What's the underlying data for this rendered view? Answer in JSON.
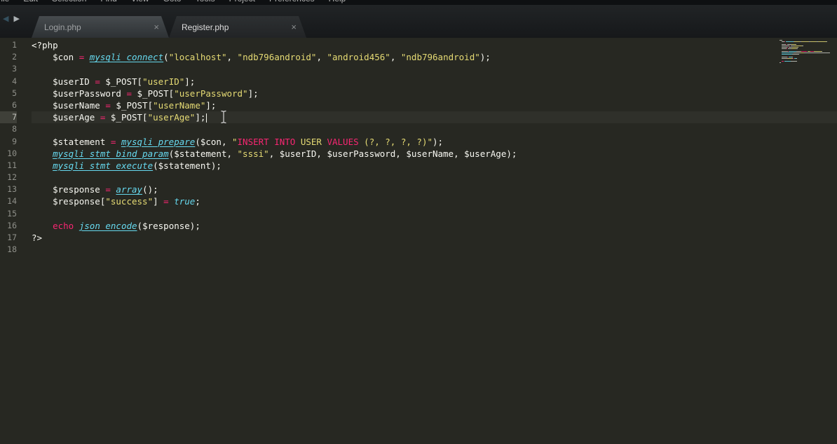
{
  "menu": {
    "items": [
      "File",
      "Edit",
      "Selection",
      "Find",
      "View",
      "Goto",
      "Tools",
      "Project",
      "Preferences",
      "Help"
    ]
  },
  "icons": {
    "back": "◀",
    "forward": "▶",
    "close": "×"
  },
  "tabs": [
    {
      "label": "Login.php",
      "active": false
    },
    {
      "label": "Register.php",
      "active": true
    }
  ],
  "editor": {
    "language": "PHP",
    "active_line": 7,
    "total_lines": 18,
    "lines": [
      {
        "num": 1,
        "segments": [
          [
            "plain",
            "<?php"
          ]
        ]
      },
      {
        "num": 2,
        "segments": [
          [
            "plain",
            "    $con "
          ],
          [
            "op",
            "="
          ],
          [
            "plain",
            " "
          ],
          [
            "fn",
            "mysqli_connect"
          ],
          [
            "plain",
            "("
          ],
          [
            "str",
            "\"localhost\""
          ],
          [
            "plain",
            ", "
          ],
          [
            "str",
            "\"ndb796android\""
          ],
          [
            "plain",
            ", "
          ],
          [
            "str",
            "\"android456\""
          ],
          [
            "plain",
            ", "
          ],
          [
            "str",
            "\"ndb796android\""
          ],
          [
            "plain",
            ");"
          ]
        ]
      },
      {
        "num": 3,
        "segments": []
      },
      {
        "num": 4,
        "segments": [
          [
            "plain",
            "    $userID "
          ],
          [
            "op",
            "="
          ],
          [
            "plain",
            " $_POST["
          ],
          [
            "str",
            "\"userID\""
          ],
          [
            "plain",
            "];"
          ]
        ]
      },
      {
        "num": 5,
        "segments": [
          [
            "plain",
            "    $userPassword "
          ],
          [
            "op",
            "="
          ],
          [
            "plain",
            " $_POST["
          ],
          [
            "str",
            "\"userPassword\""
          ],
          [
            "plain",
            "];"
          ]
        ]
      },
      {
        "num": 6,
        "segments": [
          [
            "plain",
            "    $userName "
          ],
          [
            "op",
            "="
          ],
          [
            "plain",
            " $_POST["
          ],
          [
            "str",
            "\"userName\""
          ],
          [
            "plain",
            "];"
          ]
        ]
      },
      {
        "num": 7,
        "segments": [
          [
            "plain",
            "    $userAge "
          ],
          [
            "op",
            "="
          ],
          [
            "plain",
            " $_POST["
          ],
          [
            "str",
            "\"userAge\""
          ],
          [
            "plain",
            "];"
          ]
        ]
      },
      {
        "num": 8,
        "segments": []
      },
      {
        "num": 9,
        "segments": [
          [
            "plain",
            "    $statement "
          ],
          [
            "op",
            "="
          ],
          [
            "plain",
            " "
          ],
          [
            "fn",
            "mysqli_prepare"
          ],
          [
            "plain",
            "($con, "
          ],
          [
            "str",
            "\""
          ],
          [
            "sql",
            "INSERT INTO"
          ],
          [
            "str",
            " USER "
          ],
          [
            "sql",
            "VALUES"
          ],
          [
            "str",
            " (?, ?, ?, ?)\""
          ],
          [
            "plain",
            ");"
          ]
        ]
      },
      {
        "num": 10,
        "segments": [
          [
            "plain",
            "    "
          ],
          [
            "fn",
            "mysqli_stmt_bind_param"
          ],
          [
            "plain",
            "($statement, "
          ],
          [
            "str",
            "\"sssi\""
          ],
          [
            "plain",
            ", $userID, $userPassword, $userName, $userAge);"
          ]
        ]
      },
      {
        "num": 11,
        "segments": [
          [
            "plain",
            "    "
          ],
          [
            "fn",
            "mysqli_stmt_execute"
          ],
          [
            "plain",
            "($statement);"
          ]
        ]
      },
      {
        "num": 12,
        "segments": []
      },
      {
        "num": 13,
        "segments": [
          [
            "plain",
            "    $response "
          ],
          [
            "op",
            "="
          ],
          [
            "plain",
            " "
          ],
          [
            "fn",
            "array"
          ],
          [
            "plain",
            "();"
          ]
        ]
      },
      {
        "num": 14,
        "segments": [
          [
            "plain",
            "    $response["
          ],
          [
            "str",
            "\"success\""
          ],
          [
            "plain",
            "] "
          ],
          [
            "op",
            "="
          ],
          [
            "plain",
            " "
          ],
          [
            "const",
            "true"
          ],
          [
            "plain",
            ";"
          ]
        ]
      },
      {
        "num": 15,
        "segments": []
      },
      {
        "num": 16,
        "segments": [
          [
            "plain",
            "    "
          ],
          [
            "kw",
            "echo"
          ],
          [
            "plain",
            " "
          ],
          [
            "fn",
            "json_encode"
          ],
          [
            "plain",
            "($response);"
          ]
        ]
      },
      {
        "num": 17,
        "segments": [
          [
            "plain",
            "?>"
          ]
        ]
      },
      {
        "num": 18,
        "segments": []
      }
    ]
  },
  "colors": {
    "editor_background": "#272822",
    "plain_text": "#f8f8f2",
    "keyword_pink": "#f92672",
    "function_cyan": "#66d9ef",
    "string_yellow": "#e6db74",
    "gutter_text": "#8f908a"
  }
}
